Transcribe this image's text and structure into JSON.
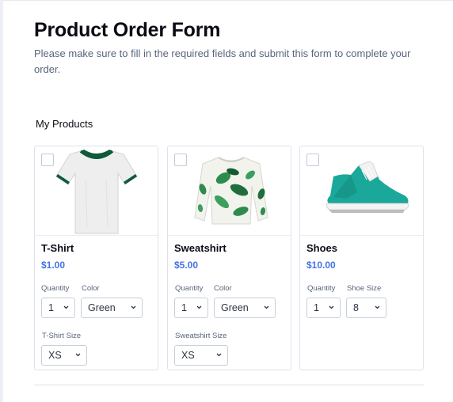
{
  "form": {
    "title": "Product Order Form",
    "subtitle": "Please make sure to fill in the required fields and submit this form to complete your order."
  },
  "section_label": "My Products",
  "colors": {
    "price": "#4573e3",
    "tshirt_trim": "#0e5a3a",
    "shoes_teal": "#1aa89a"
  },
  "products": [
    {
      "name": "T-Shirt",
      "price": "$1.00",
      "image_icon": "tshirt-icon",
      "options": {
        "quantity_label": "Quantity",
        "quantity_value": "1",
        "color_label": "Color",
        "color_value": "Green",
        "size_label": "T-Shirt Size",
        "size_value": "XS"
      }
    },
    {
      "name": "Sweatshirt",
      "price": "$5.00",
      "image_icon": "sweatshirt-icon",
      "options": {
        "quantity_label": "Quantity",
        "quantity_value": "1",
        "color_label": "Color",
        "color_value": "Green",
        "size_label": "Sweatshirt Size",
        "size_value": "XS"
      }
    },
    {
      "name": "Shoes",
      "price": "$10.00",
      "image_icon": "sneaker-icon",
      "options": {
        "quantity_label": "Quantity",
        "quantity_value": "1",
        "size_label": "Shoe Size",
        "size_value": "8"
      }
    }
  ]
}
